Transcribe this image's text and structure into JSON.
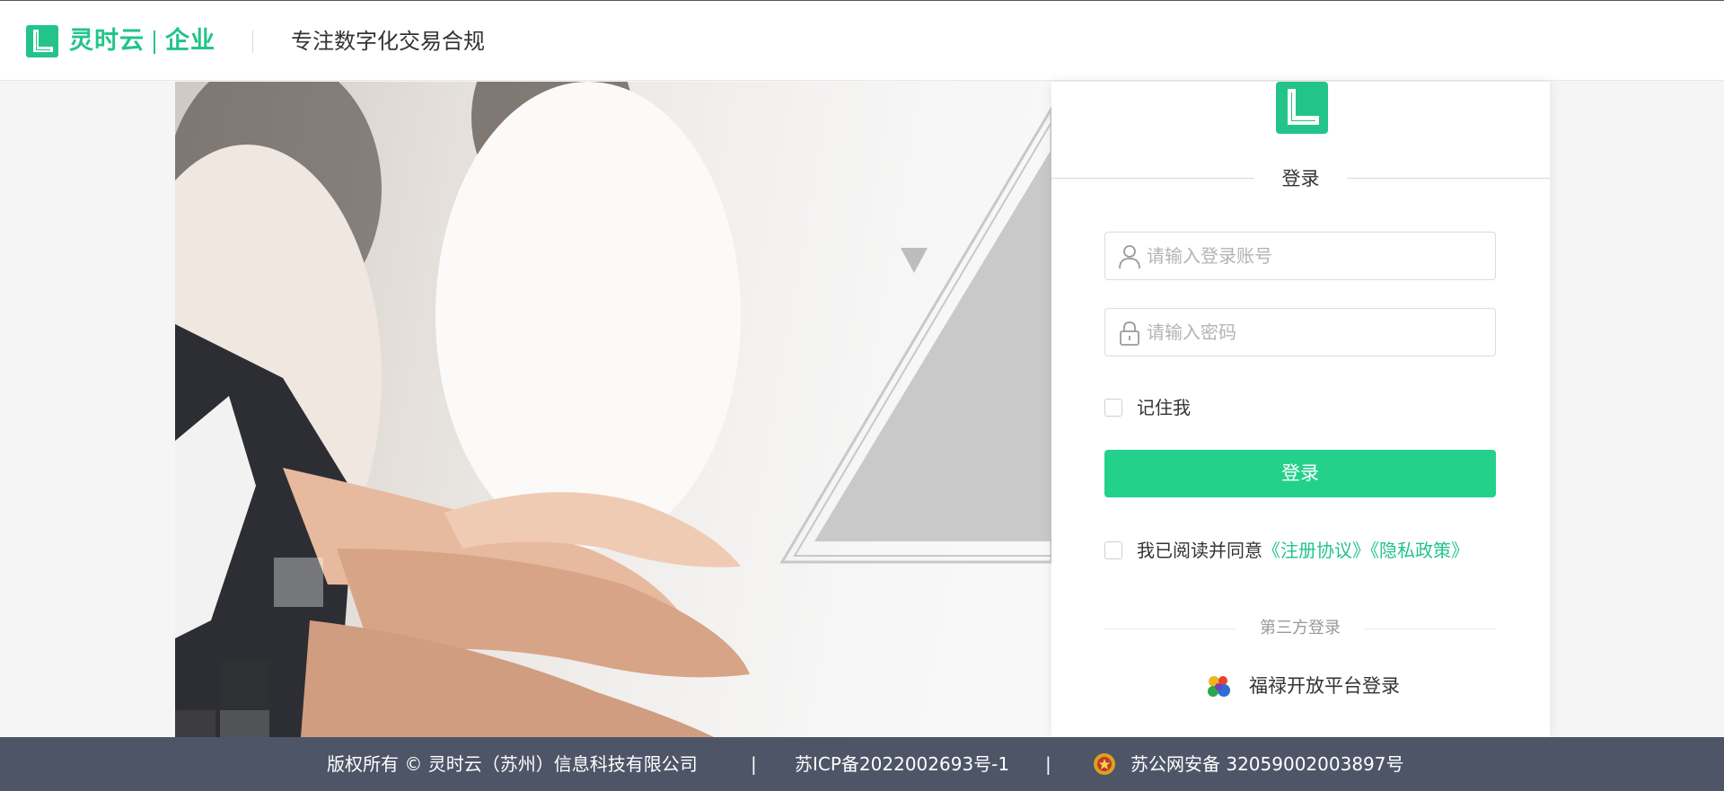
{
  "header": {
    "brand_name": "灵时云",
    "brand_sub": "企业",
    "slogan": "专注数字化交易合规"
  },
  "login": {
    "title": "登录",
    "account_placeholder": "请输入登录账号",
    "password_placeholder": "请输入密码",
    "remember_label": "记住我",
    "submit_label": "登录",
    "agree_prefix": "我已阅读并同意",
    "agreement_link": "《注册协议》",
    "privacy_link": "《隐私政策》",
    "third_party_title": "第三方登录",
    "fulu_login_label": "福禄开放平台登录"
  },
  "footer": {
    "copyright": "版权所有 © 灵时云（苏州）信息科技有限公司",
    "separator": "|",
    "icp": "苏ICP备2022002693号-1",
    "police": "苏公网安备 32059002003897号"
  },
  "colors": {
    "brand": "#23c48a",
    "button": "#23d18b",
    "footer_bg": "#4e5567"
  },
  "icons": {
    "logo": "brand-l-logo-icon",
    "account": "user-icon",
    "password": "lock-icon",
    "fulu": "fulu-logo-icon",
    "police": "police-badge-icon"
  }
}
